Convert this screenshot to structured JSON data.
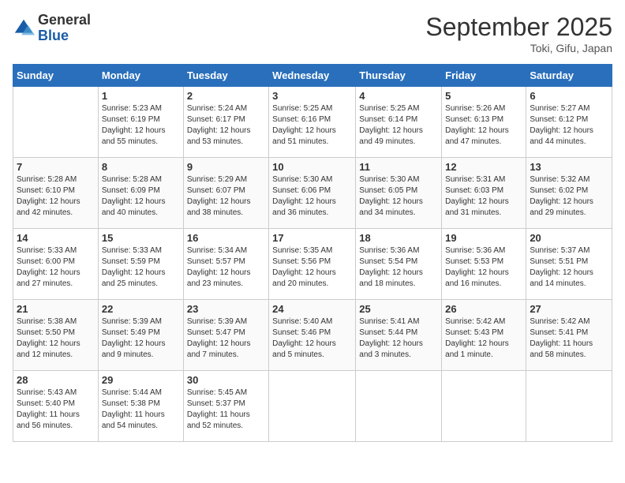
{
  "header": {
    "logo_general": "General",
    "logo_blue": "Blue",
    "month_title": "September 2025",
    "subtitle": "Toki, Gifu, Japan"
  },
  "weekdays": [
    "Sunday",
    "Monday",
    "Tuesday",
    "Wednesday",
    "Thursday",
    "Friday",
    "Saturday"
  ],
  "weeks": [
    [
      {
        "day": "",
        "info": ""
      },
      {
        "day": "1",
        "info": "Sunrise: 5:23 AM\nSunset: 6:19 PM\nDaylight: 12 hours\nand 55 minutes."
      },
      {
        "day": "2",
        "info": "Sunrise: 5:24 AM\nSunset: 6:17 PM\nDaylight: 12 hours\nand 53 minutes."
      },
      {
        "day": "3",
        "info": "Sunrise: 5:25 AM\nSunset: 6:16 PM\nDaylight: 12 hours\nand 51 minutes."
      },
      {
        "day": "4",
        "info": "Sunrise: 5:25 AM\nSunset: 6:14 PM\nDaylight: 12 hours\nand 49 minutes."
      },
      {
        "day": "5",
        "info": "Sunrise: 5:26 AM\nSunset: 6:13 PM\nDaylight: 12 hours\nand 47 minutes."
      },
      {
        "day": "6",
        "info": "Sunrise: 5:27 AM\nSunset: 6:12 PM\nDaylight: 12 hours\nand 44 minutes."
      }
    ],
    [
      {
        "day": "7",
        "info": "Sunrise: 5:28 AM\nSunset: 6:10 PM\nDaylight: 12 hours\nand 42 minutes."
      },
      {
        "day": "8",
        "info": "Sunrise: 5:28 AM\nSunset: 6:09 PM\nDaylight: 12 hours\nand 40 minutes."
      },
      {
        "day": "9",
        "info": "Sunrise: 5:29 AM\nSunset: 6:07 PM\nDaylight: 12 hours\nand 38 minutes."
      },
      {
        "day": "10",
        "info": "Sunrise: 5:30 AM\nSunset: 6:06 PM\nDaylight: 12 hours\nand 36 minutes."
      },
      {
        "day": "11",
        "info": "Sunrise: 5:30 AM\nSunset: 6:05 PM\nDaylight: 12 hours\nand 34 minutes."
      },
      {
        "day": "12",
        "info": "Sunrise: 5:31 AM\nSunset: 6:03 PM\nDaylight: 12 hours\nand 31 minutes."
      },
      {
        "day": "13",
        "info": "Sunrise: 5:32 AM\nSunset: 6:02 PM\nDaylight: 12 hours\nand 29 minutes."
      }
    ],
    [
      {
        "day": "14",
        "info": "Sunrise: 5:33 AM\nSunset: 6:00 PM\nDaylight: 12 hours\nand 27 minutes."
      },
      {
        "day": "15",
        "info": "Sunrise: 5:33 AM\nSunset: 5:59 PM\nDaylight: 12 hours\nand 25 minutes."
      },
      {
        "day": "16",
        "info": "Sunrise: 5:34 AM\nSunset: 5:57 PM\nDaylight: 12 hours\nand 23 minutes."
      },
      {
        "day": "17",
        "info": "Sunrise: 5:35 AM\nSunset: 5:56 PM\nDaylight: 12 hours\nand 20 minutes."
      },
      {
        "day": "18",
        "info": "Sunrise: 5:36 AM\nSunset: 5:54 PM\nDaylight: 12 hours\nand 18 minutes."
      },
      {
        "day": "19",
        "info": "Sunrise: 5:36 AM\nSunset: 5:53 PM\nDaylight: 12 hours\nand 16 minutes."
      },
      {
        "day": "20",
        "info": "Sunrise: 5:37 AM\nSunset: 5:51 PM\nDaylight: 12 hours\nand 14 minutes."
      }
    ],
    [
      {
        "day": "21",
        "info": "Sunrise: 5:38 AM\nSunset: 5:50 PM\nDaylight: 12 hours\nand 12 minutes."
      },
      {
        "day": "22",
        "info": "Sunrise: 5:39 AM\nSunset: 5:49 PM\nDaylight: 12 hours\nand 9 minutes."
      },
      {
        "day": "23",
        "info": "Sunrise: 5:39 AM\nSunset: 5:47 PM\nDaylight: 12 hours\nand 7 minutes."
      },
      {
        "day": "24",
        "info": "Sunrise: 5:40 AM\nSunset: 5:46 PM\nDaylight: 12 hours\nand 5 minutes."
      },
      {
        "day": "25",
        "info": "Sunrise: 5:41 AM\nSunset: 5:44 PM\nDaylight: 12 hours\nand 3 minutes."
      },
      {
        "day": "26",
        "info": "Sunrise: 5:42 AM\nSunset: 5:43 PM\nDaylight: 12 hours\nand 1 minute."
      },
      {
        "day": "27",
        "info": "Sunrise: 5:42 AM\nSunset: 5:41 PM\nDaylight: 11 hours\nand 58 minutes."
      }
    ],
    [
      {
        "day": "28",
        "info": "Sunrise: 5:43 AM\nSunset: 5:40 PM\nDaylight: 11 hours\nand 56 minutes."
      },
      {
        "day": "29",
        "info": "Sunrise: 5:44 AM\nSunset: 5:38 PM\nDaylight: 11 hours\nand 54 minutes."
      },
      {
        "day": "30",
        "info": "Sunrise: 5:45 AM\nSunset: 5:37 PM\nDaylight: 11 hours\nand 52 minutes."
      },
      {
        "day": "",
        "info": ""
      },
      {
        "day": "",
        "info": ""
      },
      {
        "day": "",
        "info": ""
      },
      {
        "day": "",
        "info": ""
      }
    ]
  ]
}
